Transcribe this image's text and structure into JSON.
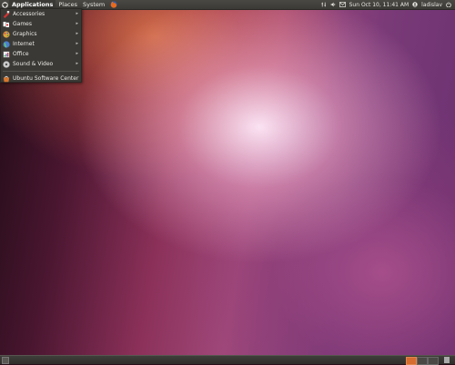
{
  "top_panel": {
    "menus": [
      "Applications",
      "Places",
      "System"
    ],
    "clock": "Sun Oct 10, 11:41 AM",
    "user": "ladislav"
  },
  "applications_menu": {
    "items": [
      {
        "label": "Accessories",
        "icon": "accessories-icon",
        "submenu": true
      },
      {
        "label": "Games",
        "icon": "games-icon",
        "submenu": true
      },
      {
        "label": "Graphics",
        "icon": "graphics-icon",
        "submenu": true
      },
      {
        "label": "Internet",
        "icon": "internet-icon",
        "submenu": true
      },
      {
        "label": "Office",
        "icon": "office-icon",
        "submenu": true
      },
      {
        "label": "Sound & Video",
        "icon": "sound-video-icon",
        "submenu": true
      }
    ],
    "footer_item": {
      "label": "Ubuntu Software Center",
      "icon": "software-center-icon"
    }
  },
  "colors": {
    "panel": "#3b3a36",
    "active_workspace": "#d66c30"
  }
}
